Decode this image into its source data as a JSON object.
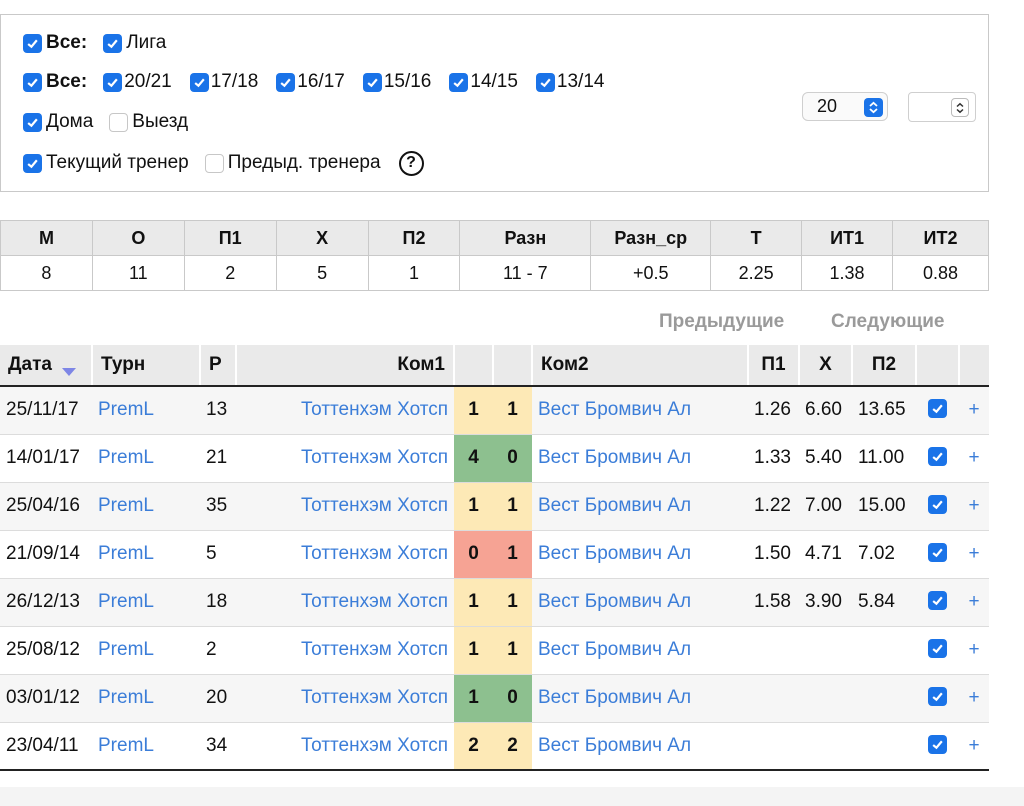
{
  "filters": {
    "row1": {
      "all_label": "Все:",
      "league_label": "Лига"
    },
    "row2": {
      "all_label": "Все:",
      "seasons": [
        "20/21",
        "17/18",
        "16/17",
        "15/16",
        "14/15",
        "13/14"
      ]
    },
    "row3": {
      "home_label": "Дома",
      "away_label": "Выезд",
      "select_value": "20",
      "spinner_value": ""
    },
    "row4": {
      "current_coach_label": "Текущий тренер",
      "prev_coach_label": "Предыд. тренера",
      "help_label": "?"
    }
  },
  "summary": {
    "headers": [
      "М",
      "О",
      "П1",
      "Х",
      "П2",
      "Разн",
      "Разн_ср",
      "Т",
      "ИТ1",
      "ИТ2"
    ],
    "values": [
      "8",
      "11",
      "2",
      "5",
      "1",
      "11 - 7",
      "+0.5",
      "2.25",
      "1.38",
      "0.88"
    ]
  },
  "nav": {
    "prev": "Предыдущие",
    "next": "Следующие"
  },
  "matches": {
    "headers": {
      "date": "Дата",
      "tourn": "Турн",
      "round": "Р",
      "team1": "Ком1",
      "team2": "Ком2",
      "p1": "П1",
      "x": "Х",
      "p2": "П2"
    },
    "rows": [
      {
        "date": "25/11/17",
        "tourn": "PremL",
        "round": "13",
        "team1": "Тоттенхэм Хотсп",
        "s1": "1",
        "s2": "1",
        "result": "draw",
        "team2": "Вест Бромвич Ал",
        "p1": "1.26",
        "x": "6.60",
        "p2": "13.65"
      },
      {
        "date": "14/01/17",
        "tourn": "PremL",
        "round": "21",
        "team1": "Тоттенхэм Хотсп",
        "s1": "4",
        "s2": "0",
        "result": "win",
        "team2": "Вест Бромвич Ал",
        "p1": "1.33",
        "x": "5.40",
        "p2": "11.00"
      },
      {
        "date": "25/04/16",
        "tourn": "PremL",
        "round": "35",
        "team1": "Тоттенхэм Хотсп",
        "s1": "1",
        "s2": "1",
        "result": "draw",
        "team2": "Вест Бромвич Ал",
        "p1": "1.22",
        "x": "7.00",
        "p2": "15.00"
      },
      {
        "date": "21/09/14",
        "tourn": "PremL",
        "round": "5",
        "team1": "Тоттенхэм Хотсп",
        "s1": "0",
        "s2": "1",
        "result": "loss",
        "team2": "Вест Бромвич Ал",
        "p1": "1.50",
        "x": "4.71",
        "p2": "7.02"
      },
      {
        "date": "26/12/13",
        "tourn": "PremL",
        "round": "18",
        "team1": "Тоттенхэм Хотсп",
        "s1": "1",
        "s2": "1",
        "result": "draw",
        "team2": "Вест Бромвич Ал",
        "p1": "1.58",
        "x": "3.90",
        "p2": "5.84"
      },
      {
        "date": "25/08/12",
        "tourn": "PremL",
        "round": "2",
        "team1": "Тоттенхэм Хотсп",
        "s1": "1",
        "s2": "1",
        "result": "draw",
        "team2": "Вест Бромвич Ал",
        "p1": "",
        "x": "",
        "p2": ""
      },
      {
        "date": "03/01/12",
        "tourn": "PremL",
        "round": "20",
        "team1": "Тоттенхэм Хотсп",
        "s1": "1",
        "s2": "0",
        "result": "win",
        "team2": "Вест Бромвич Ал",
        "p1": "",
        "x": "",
        "p2": ""
      },
      {
        "date": "23/04/11",
        "tourn": "PremL",
        "round": "34",
        "team1": "Тоттенхэм Хотсп",
        "s1": "2",
        "s2": "2",
        "result": "draw",
        "team2": "Вест Бромвич Ал",
        "p1": "",
        "x": "",
        "p2": ""
      }
    ],
    "add_symbol": "+"
  },
  "colors": {
    "accent": "#1a73e8",
    "link": "#3b7dd8",
    "win": "#8dc08f",
    "draw": "#fde9b6",
    "loss": "#f6a394",
    "header_bg": "#eaeaea"
  }
}
